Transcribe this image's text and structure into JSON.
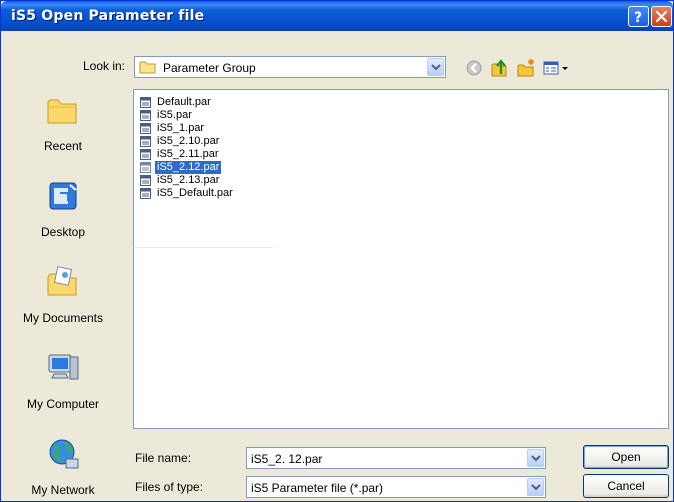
{
  "window": {
    "title": "iS5 Open Parameter file"
  },
  "look_in": {
    "label": "Look in:",
    "value": "Parameter Group"
  },
  "toolbar": {
    "icons": [
      "back-icon",
      "up-folder-icon",
      "new-folder-icon",
      "view-menu-icon"
    ]
  },
  "places": [
    {
      "label": "Recent",
      "icon": "recent-folder-icon"
    },
    {
      "label": "Desktop",
      "icon": "desktop-icon"
    },
    {
      "label": "My Documents",
      "icon": "my-documents-icon"
    },
    {
      "label": "My Computer",
      "icon": "my-computer-icon"
    },
    {
      "label": "My Network",
      "icon": "my-network-icon"
    }
  ],
  "files": [
    {
      "name": "Default.par",
      "selected": false
    },
    {
      "name": "iS5.par",
      "selected": false
    },
    {
      "name": "iS5_1.par",
      "selected": false
    },
    {
      "name": "iS5_2.10.par",
      "selected": false
    },
    {
      "name": "iS5_2.11.par",
      "selected": false
    },
    {
      "name": "iS5_2.12.par",
      "selected": true
    },
    {
      "name": "iS5_2.13.par",
      "selected": false
    },
    {
      "name": "iS5_Default.par",
      "selected": false
    }
  ],
  "file_name": {
    "label": "File name:",
    "value": "iS5_2. 12.par"
  },
  "file_type": {
    "label": "Files of type:",
    "value": "iS5 Parameter file (*.par)"
  },
  "buttons": {
    "open": "Open",
    "cancel": "Cancel"
  },
  "colors": {
    "titlebar": "#0a5ee3",
    "selection": "#316ac5",
    "dialog_bg": "#ece9d8"
  }
}
